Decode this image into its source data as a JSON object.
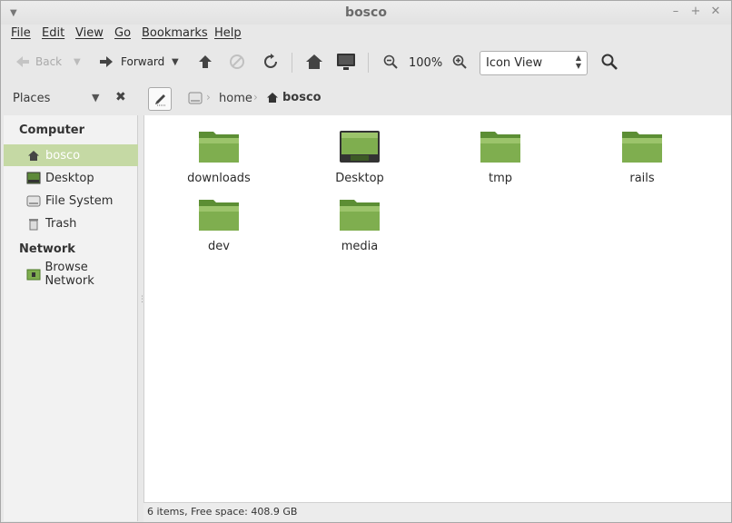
{
  "window": {
    "title": "bosco"
  },
  "menubar": [
    "File",
    "Edit",
    "View",
    "Go",
    "Bookmarks",
    "Help"
  ],
  "toolbar": {
    "back_label": "Back",
    "forward_label": "Forward",
    "zoom_level": "100%",
    "view_mode": "Icon View"
  },
  "places": {
    "header": "Places"
  },
  "breadcrumb": {
    "home": "home",
    "current": "bosco"
  },
  "sidebar": {
    "computer_heading": "Computer",
    "computer_items": [
      "bosco",
      "Desktop",
      "File System",
      "Trash"
    ],
    "network_heading": "Network",
    "network_items": [
      "Browse Network"
    ]
  },
  "files": [
    "downloads",
    "Desktop",
    "tmp",
    "rails",
    "dev",
    "media"
  ],
  "status": {
    "text": "6 items, Free space: 408.9 GB"
  },
  "colors": {
    "accent": "#c5d9a4",
    "folder": "#7fae4f"
  }
}
